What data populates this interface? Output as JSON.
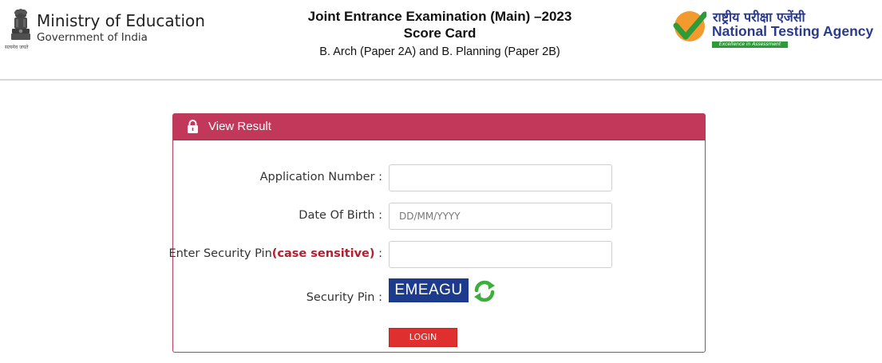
{
  "header": {
    "ministry_title": "Ministry of Education",
    "ministry_subtitle": "Government of India",
    "emblem_caption": "सत्यमेव जयते",
    "title_line1": "Joint Entrance Examination (Main) –2023",
    "title_line2": "Score Card",
    "title_line3": "B. Arch (Paper 2A) and B. Planning (Paper 2B)",
    "agency_hindi": "राष्ट्रीय परीक्षा एजेंसी",
    "agency_english": "National Testing Agency",
    "agency_tagline": "Excellence in Assessment"
  },
  "panel": {
    "title": "View Result",
    "header_color": "#c1385b",
    "application_number_label": "Application Number :",
    "application_number_value": "",
    "dob_label": "Date Of Birth :",
    "dob_placeholder": "DD/MM/YYYY",
    "security_pin_label_prefix": "Enter Security Pin",
    "security_pin_label_note": "(case sensitive)",
    "security_pin_label_suffix": " :",
    "security_pin_value": "",
    "captcha_label": "Security Pin :",
    "captcha_text": "EMEAGU",
    "login_label": "LOGIN"
  },
  "icons": {
    "emblem": "national-emblem-icon",
    "agency_logo": "nta-checkmark-logo-icon",
    "lock": "lock-icon",
    "refresh": "refresh-icon"
  }
}
